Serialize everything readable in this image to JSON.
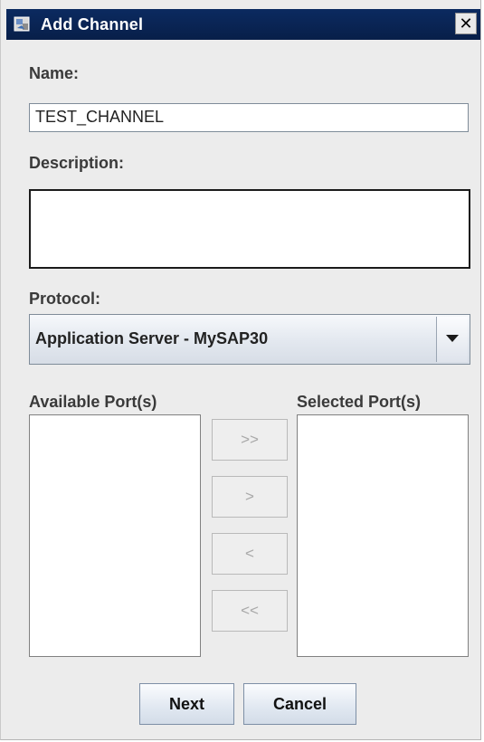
{
  "window": {
    "title": "Add Channel",
    "close_glyph": "✕",
    "icon": "app-window-icon"
  },
  "form": {
    "name_label": "Name:",
    "name_value": "TEST_CHANNEL",
    "description_label": "Description:",
    "description_value": "",
    "protocol_label": "Protocol:",
    "protocol_selected": "Application Server - MySAP30"
  },
  "ports": {
    "available_label": "Available Port(s)",
    "selected_label": "Selected Port(s)",
    "available_items": [],
    "selected_items": []
  },
  "transfer_buttons": {
    "add_all": ">>",
    "add": ">",
    "remove": "<",
    "remove_all": "<<"
  },
  "actions": {
    "next": "Next",
    "cancel": "Cancel"
  },
  "colors": {
    "titlebar": "#0b2a60",
    "dialog_bg": "#ececec",
    "disabled_text": "#a8a8a8"
  }
}
